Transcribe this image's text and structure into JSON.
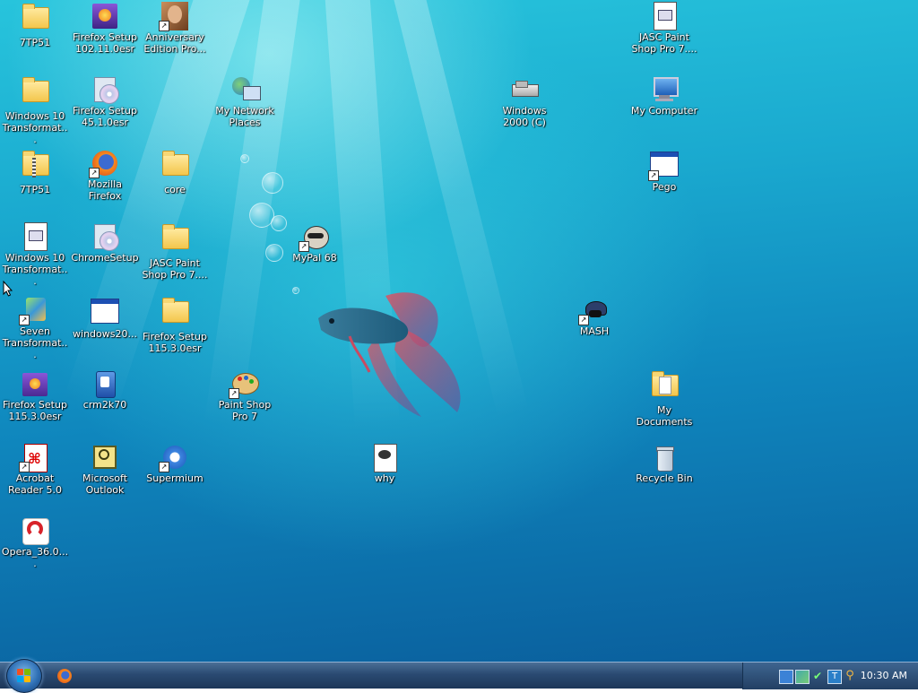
{
  "desktop": {
    "icons": [
      {
        "label": "7TP51",
        "icon": "folder-icon"
      },
      {
        "label": "Firefox Setup 102.11.0esr",
        "icon": "installer-icon"
      },
      {
        "label": "Anniversary Edition Pro...",
        "icon": "photo-shortcut-icon"
      },
      {
        "label": "JASC Paint Shop Pro 7....",
        "icon": "document-icon"
      },
      {
        "label": "Windows 10 Transformat...",
        "icon": "folder-icon"
      },
      {
        "label": "Firefox Setup 45.1.0esr",
        "icon": "setup-cd-icon"
      },
      {
        "label": "My Network Places",
        "icon": "network-icon"
      },
      {
        "label": "Windows 2000 (C)",
        "icon": "drive-icon"
      },
      {
        "label": "My Computer",
        "icon": "computer-icon"
      },
      {
        "label": "7TP51",
        "icon": "zip-folder-icon"
      },
      {
        "label": "Mozilla Firefox",
        "icon": "firefox-icon"
      },
      {
        "label": "core",
        "icon": "folder-icon"
      },
      {
        "label": "Pego",
        "icon": "window-shortcut-icon"
      },
      {
        "label": "Windows 10 Transformat...",
        "icon": "document-icon"
      },
      {
        "label": "ChromeSetup",
        "icon": "setup-cd-icon"
      },
      {
        "label": "JASC Paint Shop Pro 7....",
        "icon": "folder-icon"
      },
      {
        "label": "MyPal 68",
        "icon": "raccoon-icon"
      },
      {
        "label": "Seven Transformat...",
        "icon": "seven-shortcut-icon"
      },
      {
        "label": "windows20...",
        "icon": "window-icon"
      },
      {
        "label": "Firefox Setup 115.3.0esr",
        "icon": "folder-icon"
      },
      {
        "label": "MASH",
        "icon": "mash-icon"
      },
      {
        "label": "Firefox Setup 115.3.0esr",
        "icon": "installer-icon"
      },
      {
        "label": "crm2k70",
        "icon": "crm-icon"
      },
      {
        "label": "Paint Shop Pro 7",
        "icon": "palette-icon"
      },
      {
        "label": "My Documents",
        "icon": "documents-folder-icon"
      },
      {
        "label": "Acrobat Reader 5.0",
        "icon": "acrobat-icon"
      },
      {
        "label": "Microsoft Outlook",
        "icon": "outlook-icon"
      },
      {
        "label": "Supermium",
        "icon": "supermium-icon"
      },
      {
        "label": "why",
        "icon": "why-doc-icon"
      },
      {
        "label": "Recycle Bin",
        "icon": "recycle-bin-icon"
      },
      {
        "label": "Opera_36.0....",
        "icon": "opera-installer-icon"
      }
    ]
  },
  "taskbar": {
    "clock": "10:30 AM",
    "start_icon": "windows-orb-icon",
    "quick_launch": [
      "firefox-icon"
    ],
    "tray_icons": [
      "keyboard-icon",
      "monitor-icon",
      "network-icon",
      "safely-remove-icon",
      "input-method-icon",
      "search-icon"
    ]
  },
  "colors": {
    "desktop_top": "#27c4dc",
    "desktop_bottom": "#0a5e9c",
    "taskbar": "#2a4a72",
    "label_text": "#ffffff"
  }
}
